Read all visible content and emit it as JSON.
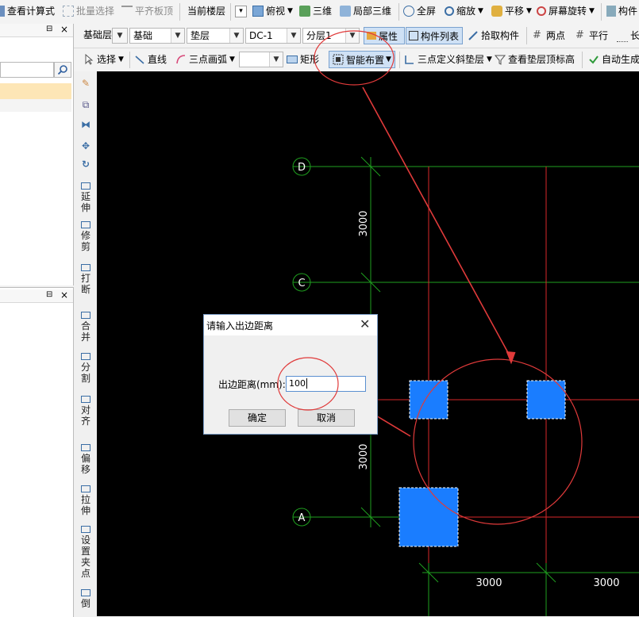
{
  "toolbar1": {
    "view_formula": "查看计算式",
    "batch_select": "批量选择",
    "align_top": "平齐板顶",
    "current_floor": "当前楼层",
    "top_view": "俯视",
    "three_d": "三维",
    "local_3d": "局部三维",
    "fullscreen": "全屏",
    "zoom": "缩放",
    "pan": "平移",
    "screen_rotate": "屏幕旋转",
    "component": "构件"
  },
  "toolbar2": {
    "floor_value": "基础层",
    "category_value": "基础",
    "type_value": "垫层",
    "component_value": "DC-1",
    "layer_value": "分层1",
    "properties": "属性",
    "component_list": "构件列表",
    "pick_component": "拾取构件",
    "two_points": "两点",
    "parallel": "平行",
    "more": "长"
  },
  "toolbar3": {
    "select": "选择",
    "line": "直线",
    "arc": "三点画弧",
    "rect": "矩形",
    "smart_layout": "智能布置",
    "slope_cushion": "三点定义斜垫层",
    "view_cushion_elev": "查看垫层顶标高",
    "auto_generate": "自动生成"
  },
  "side_tools": [
    {
      "label": "延伸"
    },
    {
      "label": "修剪"
    },
    {
      "label": "打断"
    },
    {
      "label": "合并"
    },
    {
      "label": "分割"
    },
    {
      "label": "对齐"
    },
    {
      "label": "偏移"
    },
    {
      "label": "拉伸"
    },
    {
      "label": "设置夹点"
    },
    {
      "label": "倒"
    }
  ],
  "panel": {
    "pin_symbol": "⊟",
    "close_symbol": "×"
  },
  "grid": {
    "axis_d": "D",
    "axis_c": "C",
    "axis_a": "A",
    "dim_v1": "3000",
    "dim_v2": "3000",
    "dim_h1": "3000",
    "dim_h2": "3000"
  },
  "dialog": {
    "title": "请输入出边距离",
    "field_label": "出边距离(mm):",
    "field_value": "100",
    "ok": "确定",
    "cancel": "取消"
  },
  "colors": {
    "canvas_bg": "#000000",
    "grid_green": "#1fa01f",
    "grid_red": "#d8272a",
    "cushion_blue": "#1a7dff",
    "annotation_red": "#e03a3a",
    "dialog_border": "#7a9cc6",
    "panel_selection": "#fde6b6"
  }
}
